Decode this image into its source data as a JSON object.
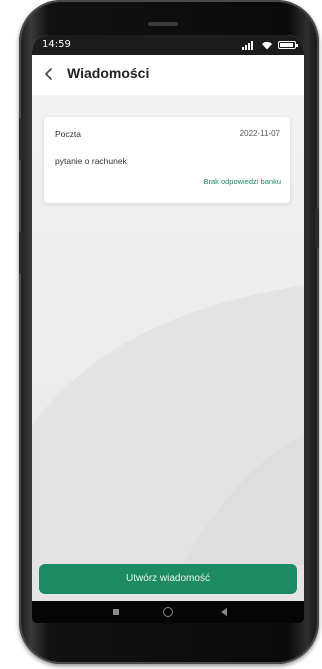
{
  "statusbar": {
    "time": "14:59",
    "icons": [
      "signal-icon",
      "wifi-icon",
      "battery-icon"
    ]
  },
  "header": {
    "back_icon": "chevron-left-icon",
    "title": "Wiadomości"
  },
  "messages": [
    {
      "type": "Poczta",
      "date": "2022-11-07",
      "subject": "pytanie o rachunek",
      "status": "Brak odpowiedzi banku",
      "status_color": "#1f8a64"
    }
  ],
  "actions": {
    "compose_label": "Utwórz wiadomość"
  },
  "colors": {
    "accent": "#1c8a62",
    "screen_background": "#efefef",
    "card_background": "#ffffff"
  },
  "navbar": {
    "icons": [
      "recents-icon",
      "home-icon",
      "back-icon"
    ]
  }
}
